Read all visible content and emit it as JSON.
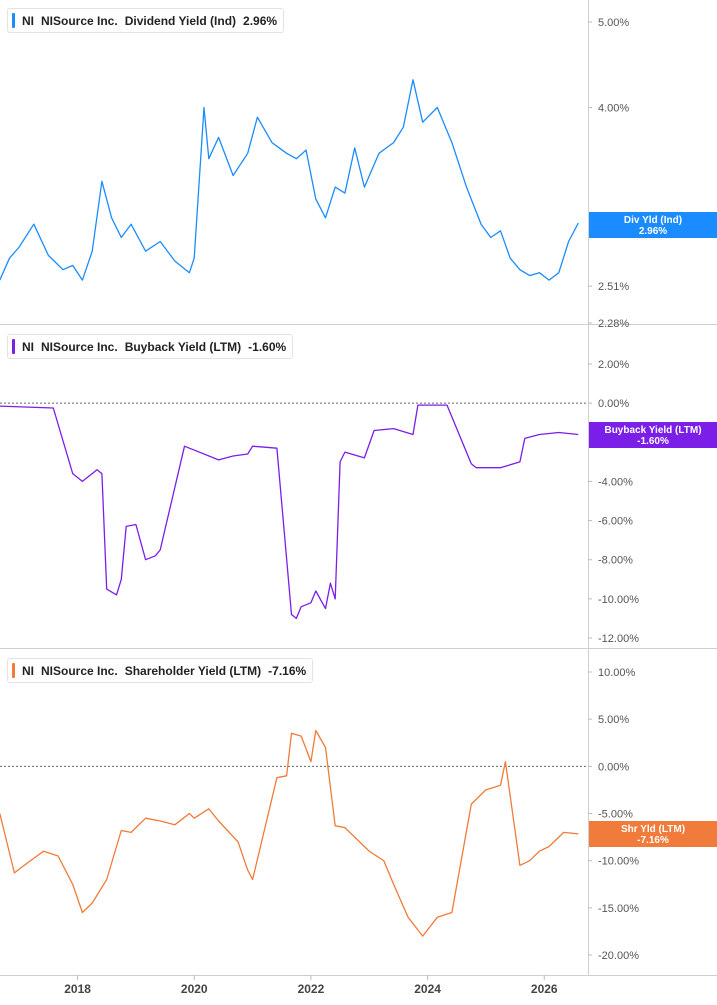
{
  "chart_data": [
    {
      "type": "line",
      "ticker": "NI",
      "company": "NISource Inc.",
      "metric": "Dividend Yield (Ind)",
      "current_value": "2.96%",
      "badge_label": "Div Yld (Ind)",
      "badge_value": "2.96%",
      "color": "#1a8cff",
      "y_ticks": [
        "5.00%",
        "4.00%",
        "2.51%",
        "2.28%"
      ],
      "y_log": true,
      "ylim": [
        2.28,
        5.25
      ],
      "series": [
        {
          "x": [
            "2016-09",
            "2016-11",
            "2017-01",
            "2017-04",
            "2017-07",
            "2017-10",
            "2017-12",
            "2018-02",
            "2018-04",
            "2018-06",
            "2018-08",
            "2018-10",
            "2018-12",
            "2019-03",
            "2019-06",
            "2019-09",
            "2019-12",
            "2020-01",
            "2020-03",
            "2020-04",
            "2020-06",
            "2020-09",
            "2020-12",
            "2021-02",
            "2021-05",
            "2021-08",
            "2021-10",
            "2021-12",
            "2022-02",
            "2022-04",
            "2022-06",
            "2022-08",
            "2022-10",
            "2022-12",
            "2023-03",
            "2023-06",
            "2023-08",
            "2023-10",
            "2023-12",
            "2024-03",
            "2024-06",
            "2024-09",
            "2024-12",
            "2025-02",
            "2025-04",
            "2025-06",
            "2025-08",
            "2025-10",
            "2025-12",
            "2026-02",
            "2026-04",
            "2026-06",
            "2026-08"
          ],
          "y": [
            2.55,
            2.7,
            2.78,
            2.95,
            2.72,
            2.62,
            2.65,
            2.55,
            2.75,
            3.3,
            3.0,
            2.85,
            2.95,
            2.75,
            2.82,
            2.68,
            2.6,
            2.7,
            4.0,
            3.5,
            3.7,
            3.35,
            3.55,
            3.9,
            3.65,
            3.55,
            3.5,
            3.58,
            3.15,
            3.0,
            3.25,
            3.2,
            3.6,
            3.25,
            3.55,
            3.65,
            3.8,
            4.3,
            3.85,
            4.0,
            3.65,
            3.25,
            2.95,
            2.85,
            2.9,
            2.7,
            2.62,
            2.58,
            2.6,
            2.55,
            2.6,
            2.82,
            2.96
          ]
        }
      ]
    },
    {
      "type": "line",
      "ticker": "NI",
      "company": "NISource Inc.",
      "metric": "Buyback Yield (LTM)",
      "current_value": "-1.60%",
      "badge_label": "Buyback Yield (LTM)",
      "badge_value": "-1.60%",
      "color": "#7b1ee8",
      "y_ticks": [
        "2.00%",
        "0.00%",
        "-4.00%",
        "-6.00%",
        "-8.00%",
        "-10.00%",
        "-12.00%"
      ],
      "ylim": [
        -12,
        2
      ],
      "series": [
        {
          "x": [
            "2016-09",
            "2017-08",
            "2017-12",
            "2018-02",
            "2018-05",
            "2018-06",
            "2018-07",
            "2018-09",
            "2018-10",
            "2018-11",
            "2019-01",
            "2019-03",
            "2019-05",
            "2019-06",
            "2019-11",
            "2020-06",
            "2020-09",
            "2020-12",
            "2021-01",
            "2021-06",
            "2021-09",
            "2021-10",
            "2021-11",
            "2022-01",
            "2022-02",
            "2022-04",
            "2022-05",
            "2022-06",
            "2022-07",
            "2022-08",
            "2022-12",
            "2023-02",
            "2023-06",
            "2023-10",
            "2023-11",
            "2024-05",
            "2024-10",
            "2024-11",
            "2025-04",
            "2025-08",
            "2025-09",
            "2025-12",
            "2026-04",
            "2026-08"
          ],
          "y": [
            -0.15,
            -0.25,
            -3.6,
            -4.0,
            -3.4,
            -3.6,
            -9.5,
            -9.8,
            -9.0,
            -6.3,
            -6.2,
            -8.0,
            -7.8,
            -7.5,
            -2.2,
            -2.9,
            -2.7,
            -2.6,
            -2.2,
            -2.3,
            -10.8,
            -11.0,
            -10.4,
            -10.2,
            -9.6,
            -10.5,
            -9.2,
            -10.0,
            -3.0,
            -2.5,
            -2.8,
            -1.4,
            -1.3,
            -1.6,
            -0.1,
            -0.1,
            -3.1,
            -3.3,
            -3.3,
            -3.0,
            -1.8,
            -1.6,
            -1.5,
            -1.6
          ]
        }
      ]
    },
    {
      "type": "line",
      "ticker": "NI",
      "company": "NISource Inc.",
      "metric": "Shareholder Yield (LTM)",
      "current_value": "-7.16%",
      "badge_label": "Shr Yld (LTM)",
      "badge_value": "-7.16%",
      "color": "#f07b3a",
      "y_ticks": [
        "10.00%",
        "5.00%",
        "0.00%",
        "-5.00%",
        "-10.00%",
        "-15.00%",
        "-20.00%"
      ],
      "x_ticks": [
        "2018",
        "2020",
        "2022",
        "2024",
        "2026"
      ],
      "ylim": [
        -20,
        10
      ],
      "series": [
        {
          "x": [
            "2016-09",
            "2016-12",
            "2017-02",
            "2017-06",
            "2017-09",
            "2017-12",
            "2018-02",
            "2018-04",
            "2018-07",
            "2018-10",
            "2018-12",
            "2019-03",
            "2019-06",
            "2019-09",
            "2019-12",
            "2020-01",
            "2020-04",
            "2020-06",
            "2020-10",
            "2020-12",
            "2021-01",
            "2021-06",
            "2021-08",
            "2021-09",
            "2021-11",
            "2022-01",
            "2022-02",
            "2022-04",
            "2022-06",
            "2022-08",
            "2022-12",
            "2023-01",
            "2023-04",
            "2023-06",
            "2023-09",
            "2023-12",
            "2024-03",
            "2024-06",
            "2024-10",
            "2025-01",
            "2025-04",
            "2025-05",
            "2025-08",
            "2025-10",
            "2025-12",
            "2026-02",
            "2026-05",
            "2026-08"
          ],
          "y": [
            -5.0,
            -11.3,
            -10.5,
            -9.0,
            -9.5,
            -12.5,
            -15.5,
            -14.5,
            -12.0,
            -6.8,
            -7.0,
            -5.5,
            -5.8,
            -6.2,
            -5.0,
            -5.5,
            -4.5,
            -5.8,
            -8.0,
            -11.0,
            -12.0,
            -1.2,
            -1.0,
            3.5,
            3.2,
            0.5,
            3.8,
            2.0,
            -6.3,
            -6.5,
            -8.5,
            -9.0,
            -10.0,
            -12.5,
            -16.0,
            -18.0,
            -16.0,
            -15.5,
            -4.0,
            -2.5,
            -2.0,
            0.5,
            -10.5,
            -10.0,
            -9.0,
            -8.5,
            -7.0,
            -7.16
          ]
        }
      ]
    }
  ]
}
